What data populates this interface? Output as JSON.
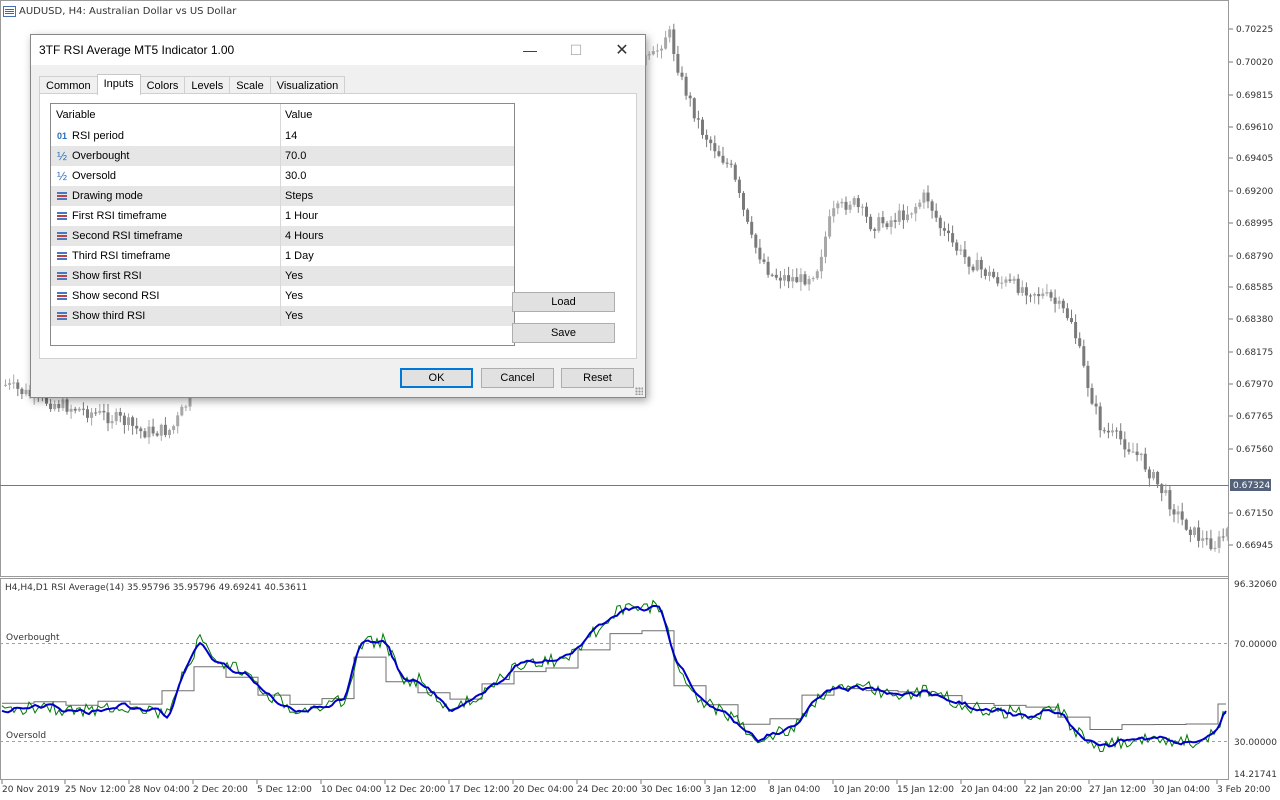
{
  "chart": {
    "title": "AUDUSD, H4:  Australian Dollar vs US Dollar",
    "price_labels": [
      "0.70225",
      "0.70020",
      "0.69815",
      "0.69610",
      "0.69405",
      "0.69200",
      "0.68995",
      "0.68790",
      "0.68585",
      "0.68380",
      "0.68175",
      "0.67970",
      "0.67765",
      "0.67560",
      "0.67324",
      "0.67150",
      "0.66945"
    ],
    "current_price": "0.67324",
    "indicator_title": "H4,H4,D1 RSI Average(14) 35.95796 35.95796 49.69241 40.53611",
    "indicator_scale": [
      "96.32060",
      "70.00000",
      "30.00000",
      "14.21741"
    ],
    "overbought_label": "Overbought",
    "oversold_label": "Oversold",
    "date_labels": [
      "20 Nov 2019",
      "25 Nov 12:00",
      "28 Nov 04:00",
      "2 Dec 20:00",
      "5 Dec 12:00",
      "10 Dec 04:00",
      "12 Dec 20:00",
      "17 Dec 12:00",
      "20 Dec 04:00",
      "24 Dec 20:00",
      "30 Dec 16:00",
      "3 Jan 12:00",
      "8 Jan 04:00",
      "10 Jan 20:00",
      "15 Jan 12:00",
      "20 Jan 04:00",
      "22 Jan 20:00",
      "27 Jan 12:00",
      "30 Jan 04:00",
      "3 Feb 20:00"
    ],
    "colors": {
      "up": "#a8a8a8",
      "down": "#7a7a7a",
      "rsi_avg": "#0000c8",
      "rsi_green": "#007800",
      "rsi_gray": "#6e6e6e"
    }
  },
  "dialog": {
    "title": "3TF RSI Average MT5 Indicator 1.00",
    "tabs": [
      "Common",
      "Inputs",
      "Colors",
      "Levels",
      "Scale",
      "Visualization"
    ],
    "active_tab": "Inputs",
    "table_headers": {
      "variable": "Variable",
      "value": "Value"
    },
    "params": [
      {
        "icon": "int",
        "name": "RSI period",
        "value": "14"
      },
      {
        "icon": "dbl",
        "name": "Overbought",
        "value": "70.0"
      },
      {
        "icon": "dbl",
        "name": "Oversold",
        "value": "30.0"
      },
      {
        "icon": "enum",
        "name": "Drawing mode",
        "value": "Steps"
      },
      {
        "icon": "enum",
        "name": "First RSI timeframe",
        "value": "1 Hour"
      },
      {
        "icon": "enum",
        "name": "Second RSI timeframe",
        "value": "4 Hours"
      },
      {
        "icon": "enum",
        "name": "Third RSI timeframe",
        "value": "1 Day"
      },
      {
        "icon": "enum",
        "name": "Show first RSI",
        "value": "Yes"
      },
      {
        "icon": "enum",
        "name": "Show second RSI",
        "value": "Yes"
      },
      {
        "icon": "enum",
        "name": "Show third RSI",
        "value": "Yes"
      }
    ],
    "buttons": {
      "load": "Load",
      "save": "Save",
      "ok": "OK",
      "cancel": "Cancel",
      "reset": "Reset"
    }
  }
}
